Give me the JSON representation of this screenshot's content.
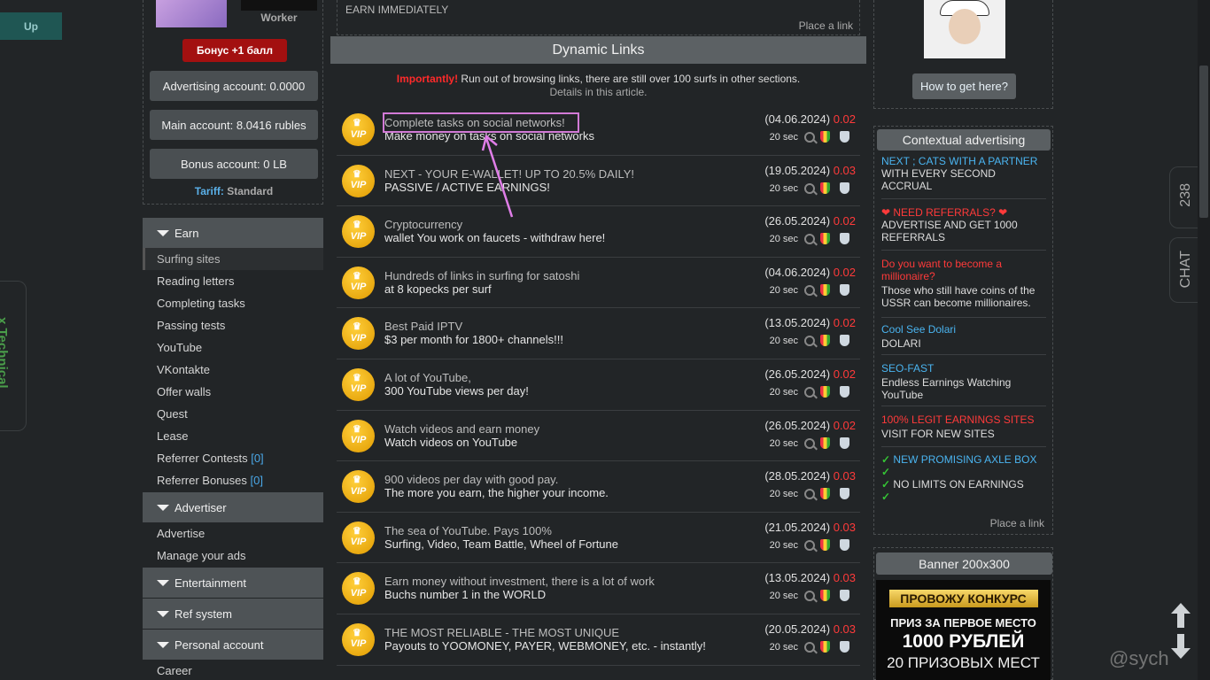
{
  "up_label": "Up",
  "technical_label": "x Technical",
  "profile": {
    "worker_label": "Worker",
    "bonus_label": "Бонус +1 балл",
    "accounts": [
      "Advertising account: 0.0000",
      "Main account: 8.0416 rubles",
      "Bonus account: 0 LB"
    ],
    "tariff_key": "Tariff:",
    "tariff_value": "Standard"
  },
  "menu": {
    "earn": "Earn",
    "earn_items": [
      {
        "label": "Surfing sites"
      },
      {
        "label": "Reading letters"
      },
      {
        "label": "Completing tasks"
      },
      {
        "label": "Passing tests"
      },
      {
        "label": "YouTube"
      },
      {
        "label": "VKontakte"
      },
      {
        "label": "Offer walls"
      },
      {
        "label": "Quest"
      },
      {
        "label": "Lease"
      },
      {
        "label": "Referrer Contests",
        "count": "[0]"
      },
      {
        "label": "Referrer Bonuses",
        "count": "[0]"
      }
    ],
    "advertiser": "Advertiser",
    "advertiser_items": [
      "Advertise",
      "Manage your ads"
    ],
    "entertainment": "Entertainment",
    "ref_system": "Ref system",
    "personal": "Personal account",
    "personal_items": [
      "Career"
    ]
  },
  "center": {
    "earn_immediately": "EARN IMMEDIATELY",
    "place_link": "Place a link",
    "title": "Dynamic Links",
    "notice_imp": "Importantly!",
    "notice_text": " Run out of browsing links, there are still over 100 surfs in other sections.",
    "notice_details": "Details in this article.",
    "vip_label": "VIP",
    "sec_label": "20 sec",
    "links": [
      {
        "t1": "Complete tasks on social networks!",
        "t2": "Make money on tasks on social networks",
        "date": "(04.06.2024)",
        "price": "0.02"
      },
      {
        "t1": "NEXT - YOUR E-WALLET! UP TO 20.5% DAILY!",
        "t2": "PASSIVE / ACTIVE EARNINGS!",
        "date": "(19.05.2024)",
        "price": "0.03"
      },
      {
        "t1": "Cryptocurrency",
        "t2": "wallet You work on faucets - withdraw here!",
        "date": "(26.05.2024)",
        "price": "0.02"
      },
      {
        "t1": "Hundreds of links in surfing for satoshi",
        "t2": "at 8 kopecks per surf",
        "date": "(04.06.2024)",
        "price": "0.02"
      },
      {
        "t1": "Best Paid IPTV",
        "t2": "$3 per month for 1800+ channels!!!",
        "date": "(13.05.2024)",
        "price": "0.02"
      },
      {
        "t1": "A lot of YouTube,",
        "t2": "300 YouTube views per day!",
        "date": "(26.05.2024)",
        "price": "0.02"
      },
      {
        "t1": "Watch videos and earn money",
        "t2": "Watch videos on YouTube",
        "date": "(26.05.2024)",
        "price": "0.02"
      },
      {
        "t1": "900 videos per day with good pay.",
        "t2": "The more you earn, the higher your income.",
        "date": "(28.05.2024)",
        "price": "0.03"
      },
      {
        "t1": "The sea of YouTube. Pays 100%",
        "t2": "Surfing, Video, Team Battle, Wheel of Fortune",
        "date": "(21.05.2024)",
        "price": "0.03"
      },
      {
        "t1": "Earn money without investment, there is a lot of work",
        "t2": "Buchs number 1 in the WORLD",
        "date": "(13.05.2024)",
        "price": "0.03"
      },
      {
        "t1": "THE MOST RELIABLE - THE MOST UNIQUE",
        "t2": "Payouts to YOOMONEY, PAYER, WEBMONEY, etc. - instantly!",
        "date": "(20.05.2024)",
        "price": "0.03"
      }
    ]
  },
  "right": {
    "how_label": "How to get here?",
    "ctx_title": "Contextual advertising",
    "ads": [
      {
        "h": "NEXT ; CATS WITH A PARTNER",
        "b": "WITH EVERY SECOND ACCRUAL"
      },
      {
        "h": "❤ NEED REFERRALS? ❤",
        "b": "ADVERTISE AND GET 1000 REFERRALS"
      },
      {
        "h": "Do you want to become a millionaire?",
        "b": "Those who still have coins of the USSR can become millionaires."
      },
      {
        "h": "Cool See Dolari",
        "b": "DOLARI"
      },
      {
        "h": "SEO-FAST",
        "b": "Endless Earnings Watching YouTube"
      },
      {
        "h": "100% LEGIT EARNINGS SITES",
        "b": "VISIT FOR NEW SITES"
      },
      {
        "h": "NEW PROMISING AXLE BOX",
        "b": "NO LIMITS ON EARNINGS"
      }
    ],
    "place_link": "Place a link",
    "banner_title": "Banner 200x300",
    "banner_lines": [
      "ПРОВОЖУ КОНКУРС",
      "ПРИЗ ЗА ПЕРВОЕ МЕСТО",
      "1000 РУБЛЕЙ",
      "20 ПРИЗОВЫХ МЕСТ"
    ]
  },
  "side": {
    "count": "238",
    "chat": "CHAT"
  },
  "watermark": "@sych"
}
